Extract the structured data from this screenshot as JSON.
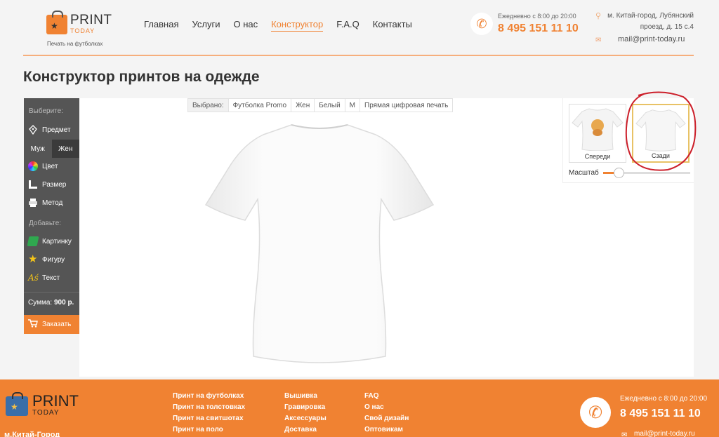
{
  "header": {
    "logo_print": "PRINT",
    "logo_today": "TODAY",
    "logo_tagline": "Печать на футболках",
    "nav": [
      {
        "label": "Главная",
        "active": false
      },
      {
        "label": "Услуги",
        "active": false
      },
      {
        "label": "О нас",
        "active": false
      },
      {
        "label": "Конструктор",
        "active": true
      },
      {
        "label": "F.A.Q",
        "active": false
      },
      {
        "label": "Контакты",
        "active": false
      }
    ],
    "hours": "Ежедневно с 8:00 до 20:00",
    "phone": "8 495 151 11 10",
    "address": "м. Китай-город, Лубянский проезд, д. 15 с.4",
    "email": "mail@print-today.ru"
  },
  "page_title": "Конструктор принтов на одежде",
  "sidebar": {
    "choose_label": "Выберите:",
    "items_choose": [
      {
        "label": "Предмет",
        "icon": "pen-nib-icon"
      }
    ],
    "sex": {
      "male": "Муж",
      "female": "Жен",
      "selected": "female"
    },
    "items_choose2": [
      {
        "label": "Цвет",
        "icon": "color-wheel-icon"
      },
      {
        "label": "Размер",
        "icon": "ruler-icon"
      },
      {
        "label": "Метод",
        "icon": "printer-icon"
      }
    ],
    "add_label": "Добавьте:",
    "items_add": [
      {
        "label": "Картинку",
        "icon": "picture-icon"
      },
      {
        "label": "Фигуру",
        "icon": "star-icon"
      },
      {
        "label": "Текст",
        "icon": "text-icon"
      }
    ],
    "sum_label": "Сумма:",
    "sum_value": "900 р.",
    "order_label": "Заказать"
  },
  "selection": {
    "label": "Выбрано:",
    "values": [
      "Футболка Promo",
      "Жен",
      "Белый",
      "M",
      "Прямая цифровая печать"
    ]
  },
  "views": {
    "front_label": "Спереди",
    "back_label": "Сзади",
    "selected": "back"
  },
  "scale": {
    "label": "Масштаб",
    "value": 0.18
  },
  "colors": {
    "accent": "#f08232",
    "sidebar": "#555555",
    "highlight": "#e8c266",
    "annotation": "#cc1f2a"
  },
  "footer": {
    "logo_print": "PRINT",
    "logo_today": "TODAY",
    "metro": "м.Китай-Город",
    "col1": [
      "Принт на футболках",
      "Принт на толстовках",
      "Принт на свитшотах",
      "Принт на поло"
    ],
    "col2": [
      "Вышивка",
      "Гравировка",
      "Аксессуары",
      "Доставка"
    ],
    "col3": [
      "FAQ",
      "О нас",
      "Свой дизайн",
      "Оптовикам"
    ],
    "hours": "Ежедневно с 8:00 до 20:00",
    "phone": "8 495 151 11 10",
    "email": "mail@print-today.ru"
  }
}
